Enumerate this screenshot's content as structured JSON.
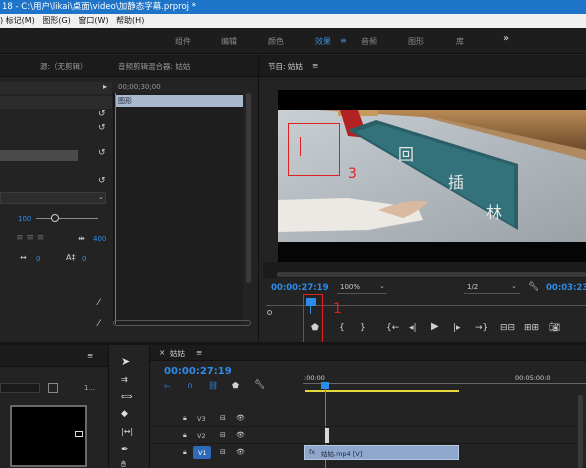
{
  "titlebar": {
    "text": "18 - C:\\用户\\likai\\桌面\\video\\加静态字幕.prproj *"
  },
  "menubar": {
    "items": [
      ") 标记(M)",
      "图形(G)",
      "窗口(W)",
      "帮助(H)"
    ]
  },
  "workspace": {
    "tabs": [
      "组件",
      "编辑",
      "颜色",
      "效果",
      "音频",
      "图形",
      "库"
    ],
    "active": "效果",
    "menu_glyph": "≡",
    "more": "»"
  },
  "source_panel": {
    "source_tab": "源:（无剪辑）",
    "mixer_tab": "音频剪辑混合器: 姑姑",
    "timecode": "00;00;30;00",
    "clip_label": "图形",
    "scale_value": "100",
    "anchor_value": "400",
    "value_a": "0",
    "value_b": "0"
  },
  "program_monitor": {
    "title": "节目: 姑姑",
    "menu_glyph": "≡",
    "timecode": "00:00:27:19",
    "zoom": "100%",
    "resolution": "1/2",
    "duration": "00:03:23"
  },
  "annotations": {
    "label1": "1",
    "label3": "3"
  },
  "timeline": {
    "tab_close": "×",
    "sequence_name": "姑姑",
    "menu_glyph": "≡",
    "timecode": "00:00:27:19",
    "ruler_start": ":00:00",
    "ruler_mid": "00:05:00:0",
    "tracks": [
      "V3",
      "V2",
      "V1"
    ],
    "clip_name": "姑姑.mp4 [V]"
  },
  "project_panel": {
    "menu_glyph": "≡",
    "count": "1..."
  },
  "colors": {
    "accent": "#2d8ceb",
    "annotation": "#e02020",
    "titlebar": "#1e74c9",
    "clip": "#8fa7cc"
  }
}
